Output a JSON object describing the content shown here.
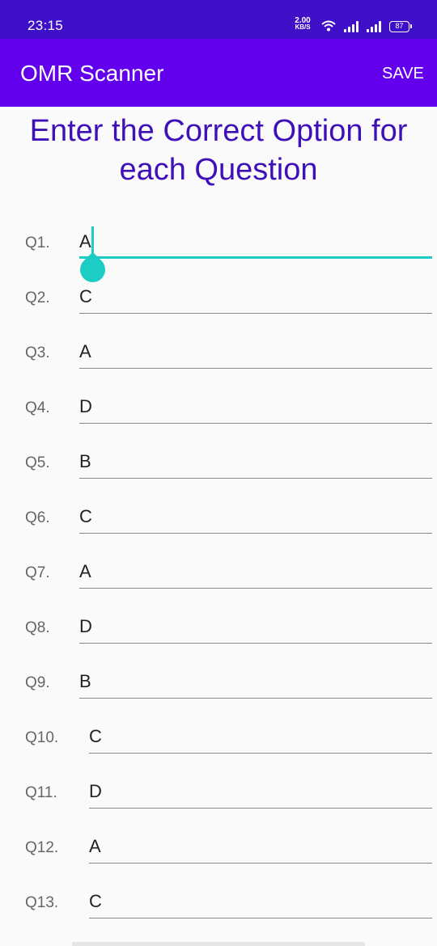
{
  "status_bar": {
    "time": "23:15",
    "speed_value": "2.00",
    "speed_unit": "KB/S",
    "battery": "87"
  },
  "app_bar": {
    "title": "OMR Scanner",
    "save_label": "SAVE"
  },
  "heading": {
    "line1": "Enter the Correct Option for",
    "line2": "each Question"
  },
  "questions": [
    {
      "label": "Q1.",
      "answer": "A"
    },
    {
      "label": "Q2.",
      "answer": "C"
    },
    {
      "label": "Q3.",
      "answer": "A"
    },
    {
      "label": "Q4.",
      "answer": "D"
    },
    {
      "label": "Q5.",
      "answer": "B"
    },
    {
      "label": "Q6.",
      "answer": "C"
    },
    {
      "label": "Q7.",
      "answer": "A"
    },
    {
      "label": "Q8.",
      "answer": "D"
    },
    {
      "label": "Q9.",
      "answer": "B"
    },
    {
      "label": "Q10.",
      "answer": "C"
    },
    {
      "label": "Q11.",
      "answer": "D"
    },
    {
      "label": "Q12.",
      "answer": "A"
    },
    {
      "label": "Q13.",
      "answer": "C"
    }
  ],
  "colors": {
    "status_bar": "#3f10c8",
    "app_bar": "#6200ee",
    "heading": "#3f10b8",
    "accent": "#1ccdc3"
  }
}
